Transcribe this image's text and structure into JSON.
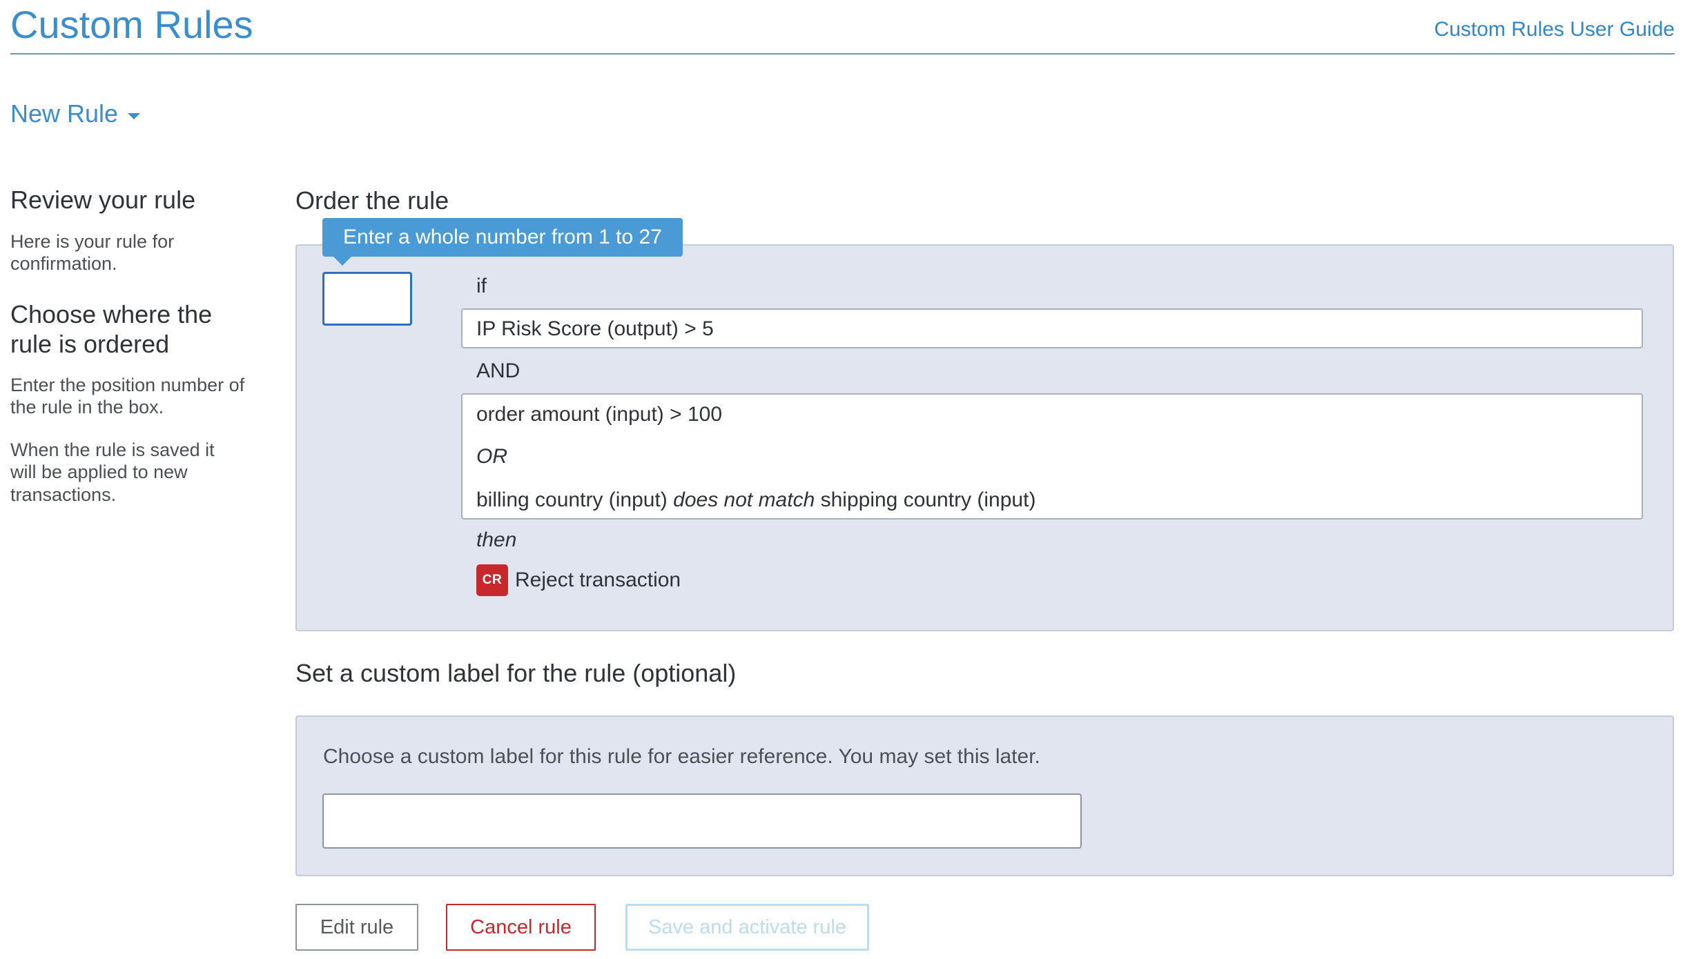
{
  "header": {
    "title": "Custom Rules",
    "guide_link": "Custom Rules User Guide"
  },
  "rule_menu": {
    "label": "New Rule",
    "icon": "caret-down-icon"
  },
  "sidebar": {
    "review_heading": "Review your rule",
    "review_text": "Here is your rule for confirmation.",
    "order_heading": "Choose where the rule is ordered",
    "order_text": "Enter the position number of the rule in the box.",
    "apply_text": "When the rule is saved it will be applied to new transactions."
  },
  "order_section": {
    "title": "Order the rule",
    "tooltip": "Enter a whole number from 1 to 27",
    "position_value": "",
    "if_label": "if",
    "condition_1": "IP Risk Score (output) > 5",
    "and_label": "AND",
    "condition_2": {
      "line_1": "order amount (input) > 100",
      "or_label": "OR",
      "line_3_pre": "billing country (input) ",
      "line_3_op": "does not match",
      "line_3_post": " shipping country (input)"
    },
    "then_label": "then",
    "action": {
      "badge": "CR",
      "label": "Reject transaction",
      "badge_color": "#c6282b"
    }
  },
  "label_section": {
    "title": "Set a custom label for the rule (optional)",
    "help_text": "Choose a custom label for this rule for easier reference. You may set this later.",
    "input_value": "",
    "input_placeholder": ""
  },
  "buttons": {
    "edit": "Edit rule",
    "cancel": "Cancel rule",
    "save": "Save and activate rule"
  },
  "colors": {
    "accent": "#3a8fcb",
    "panel_bg": "#e1e5ef",
    "danger": "#c6282b",
    "tooltip_bg": "#4a9ad6",
    "disabled": "#bcdcf2"
  }
}
